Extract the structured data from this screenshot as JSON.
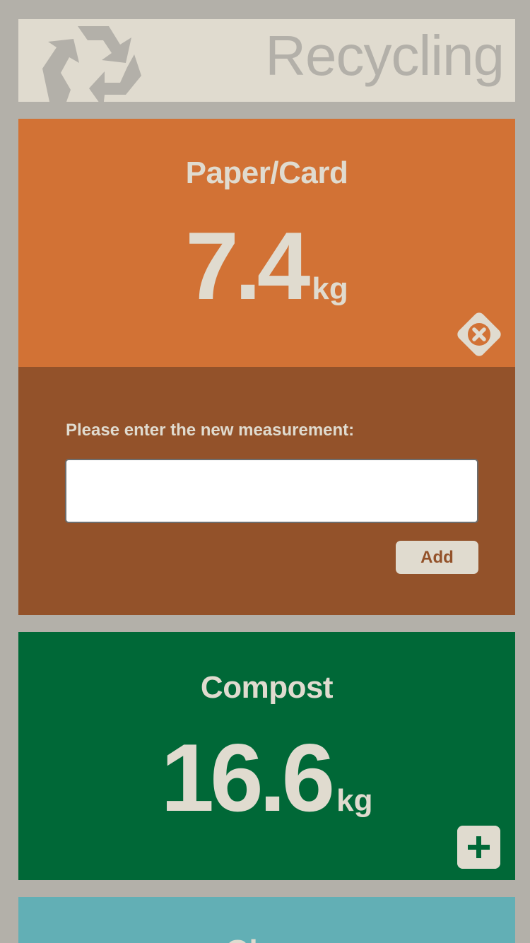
{
  "header": {
    "title": "Recycling",
    "logo_icon": "recycle-icon"
  },
  "categories": [
    {
      "name": "Paper/Card",
      "value": "7.4",
      "unit": "kg",
      "color": "#d27235",
      "action_icon": "close-icon",
      "expanded": true
    },
    {
      "name": "Compost",
      "value": "16.6",
      "unit": "kg",
      "color": "#006837",
      "action_icon": "plus-icon",
      "expanded": false
    },
    {
      "name": "Glass",
      "color": "#62afb5",
      "expanded": false
    }
  ],
  "entry": {
    "prompt": "Please enter the new measurement:",
    "value": "",
    "placeholder": "",
    "add_label": "Add",
    "color": "#93522a"
  },
  "colors": {
    "background": "#b3b0a9",
    "text_light": "#e0dbcf"
  }
}
